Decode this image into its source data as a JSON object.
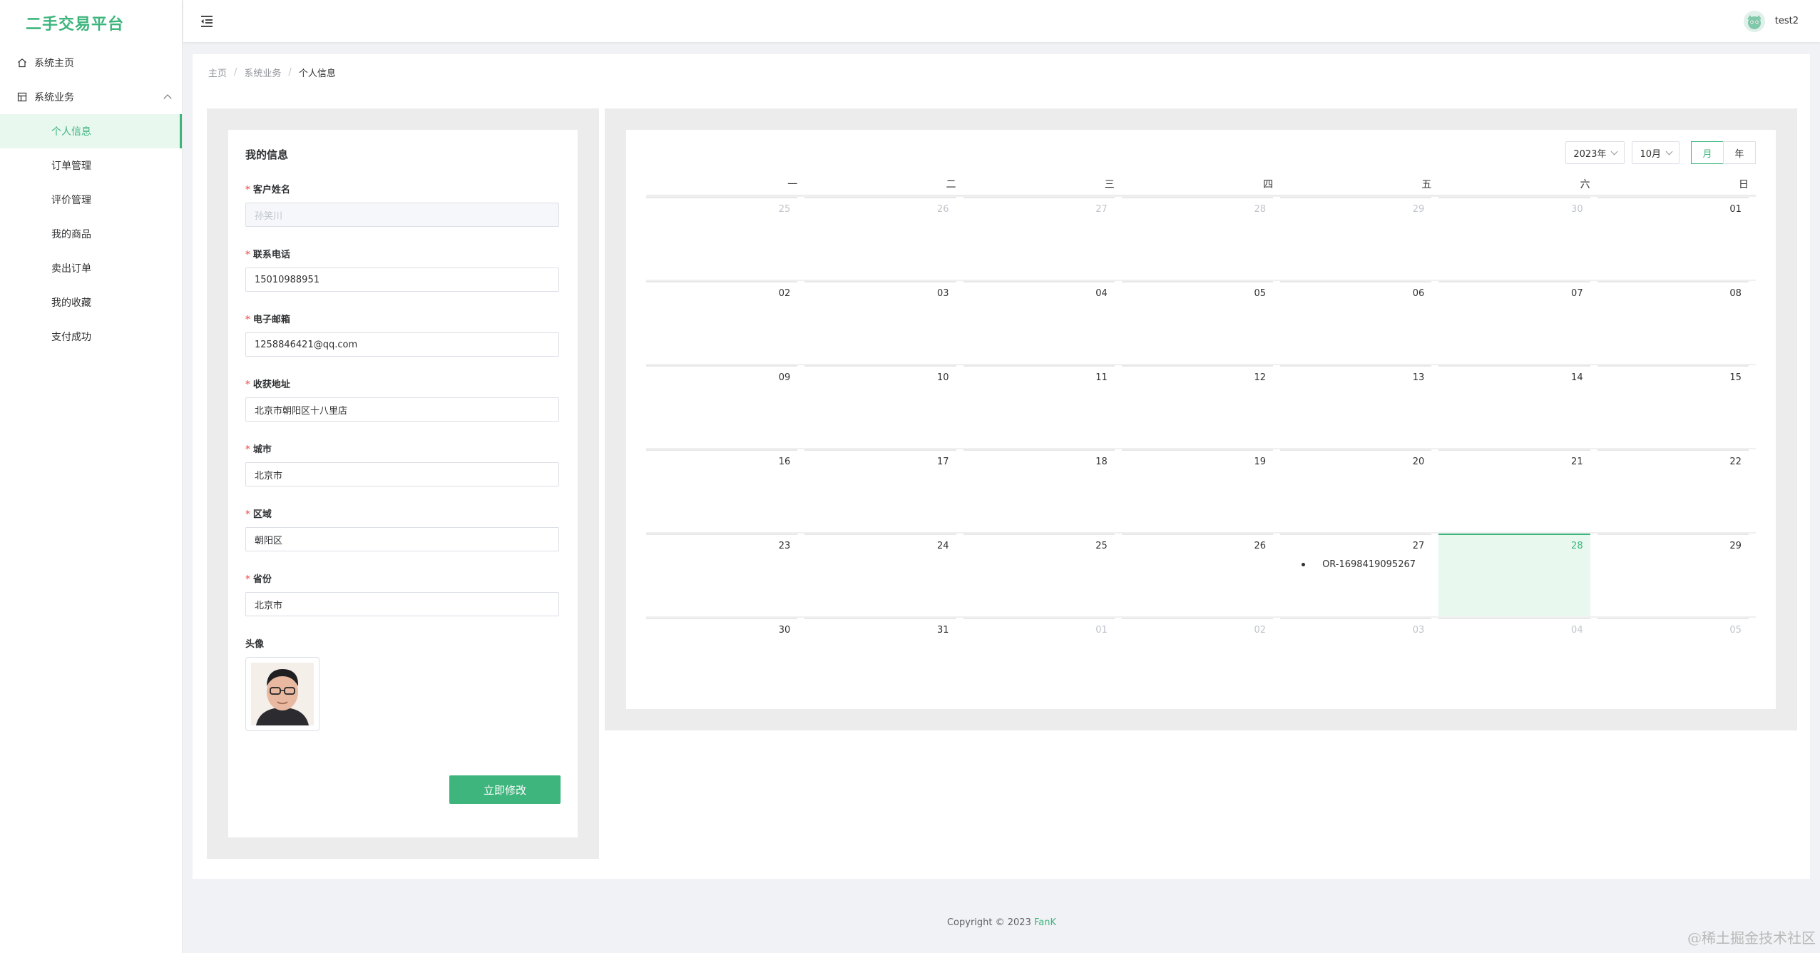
{
  "app": {
    "logo": "二手交易平台"
  },
  "sidebar": {
    "items": [
      {
        "label": "系统主页",
        "icon": "home-icon"
      },
      {
        "label": "系统业务",
        "icon": "grid-icon",
        "expanded": true
      }
    ],
    "submenu": [
      {
        "label": "个人信息",
        "active": true
      },
      {
        "label": "订单管理"
      },
      {
        "label": "评价管理"
      },
      {
        "label": "我的商品"
      },
      {
        "label": "卖出订单"
      },
      {
        "label": "我的收藏"
      },
      {
        "label": "支付成功"
      }
    ]
  },
  "header": {
    "username": "test2"
  },
  "breadcrumb": [
    "主页",
    "系统业务",
    "个人信息"
  ],
  "form": {
    "title": "我的信息",
    "fields": [
      {
        "label": "客户姓名",
        "value": "孙笑川",
        "required": true,
        "disabled": true
      },
      {
        "label": "联系电话",
        "value": "15010988951",
        "required": true
      },
      {
        "label": "电子邮箱",
        "value": "1258846421@qq.com",
        "required": true
      },
      {
        "label": "收获地址",
        "value": "北京市朝阳区十八里店",
        "required": true
      },
      {
        "label": "城市",
        "value": "北京市",
        "required": true
      },
      {
        "label": "区域",
        "value": "朝阳区",
        "required": true
      },
      {
        "label": "省份",
        "value": "北京市",
        "required": true
      }
    ],
    "avatar_label": "头像",
    "submit_label": "立即修改"
  },
  "calendar": {
    "year": "2023年",
    "month": "10月",
    "modes": [
      "月",
      "年"
    ],
    "active_mode": "月",
    "weekdays": [
      "一",
      "二",
      "三",
      "四",
      "五",
      "六",
      "日"
    ],
    "weeks": [
      [
        {
          "d": "25",
          "muted": true
        },
        {
          "d": "26",
          "muted": true
        },
        {
          "d": "27",
          "muted": true
        },
        {
          "d": "28",
          "muted": true
        },
        {
          "d": "29",
          "muted": true
        },
        {
          "d": "30",
          "muted": true
        },
        {
          "d": "01"
        }
      ],
      [
        {
          "d": "02"
        },
        {
          "d": "03"
        },
        {
          "d": "04"
        },
        {
          "d": "05"
        },
        {
          "d": "06"
        },
        {
          "d": "07"
        },
        {
          "d": "08"
        }
      ],
      [
        {
          "d": "09"
        },
        {
          "d": "10"
        },
        {
          "d": "11"
        },
        {
          "d": "12"
        },
        {
          "d": "13"
        },
        {
          "d": "14"
        },
        {
          "d": "15"
        }
      ],
      [
        {
          "d": "16"
        },
        {
          "d": "17"
        },
        {
          "d": "18"
        },
        {
          "d": "19"
        },
        {
          "d": "20"
        },
        {
          "d": "21"
        },
        {
          "d": "22"
        }
      ],
      [
        {
          "d": "23"
        },
        {
          "d": "24"
        },
        {
          "d": "25"
        },
        {
          "d": "26"
        },
        {
          "d": "27",
          "event": "OR-1698419095267"
        },
        {
          "d": "28",
          "today": true
        },
        {
          "d": "29"
        }
      ],
      [
        {
          "d": "30"
        },
        {
          "d": "31"
        },
        {
          "d": "01",
          "muted": true
        },
        {
          "d": "02",
          "muted": true
        },
        {
          "d": "03",
          "muted": true
        },
        {
          "d": "04",
          "muted": true
        },
        {
          "d": "05",
          "muted": true
        }
      ]
    ]
  },
  "footer": {
    "copyright": "Copyright © 2023",
    "brand": "FanK"
  },
  "watermark": "@稀土掘金技术社区",
  "colors": {
    "accent": "#3eb57d",
    "required": "#f56c6c"
  }
}
